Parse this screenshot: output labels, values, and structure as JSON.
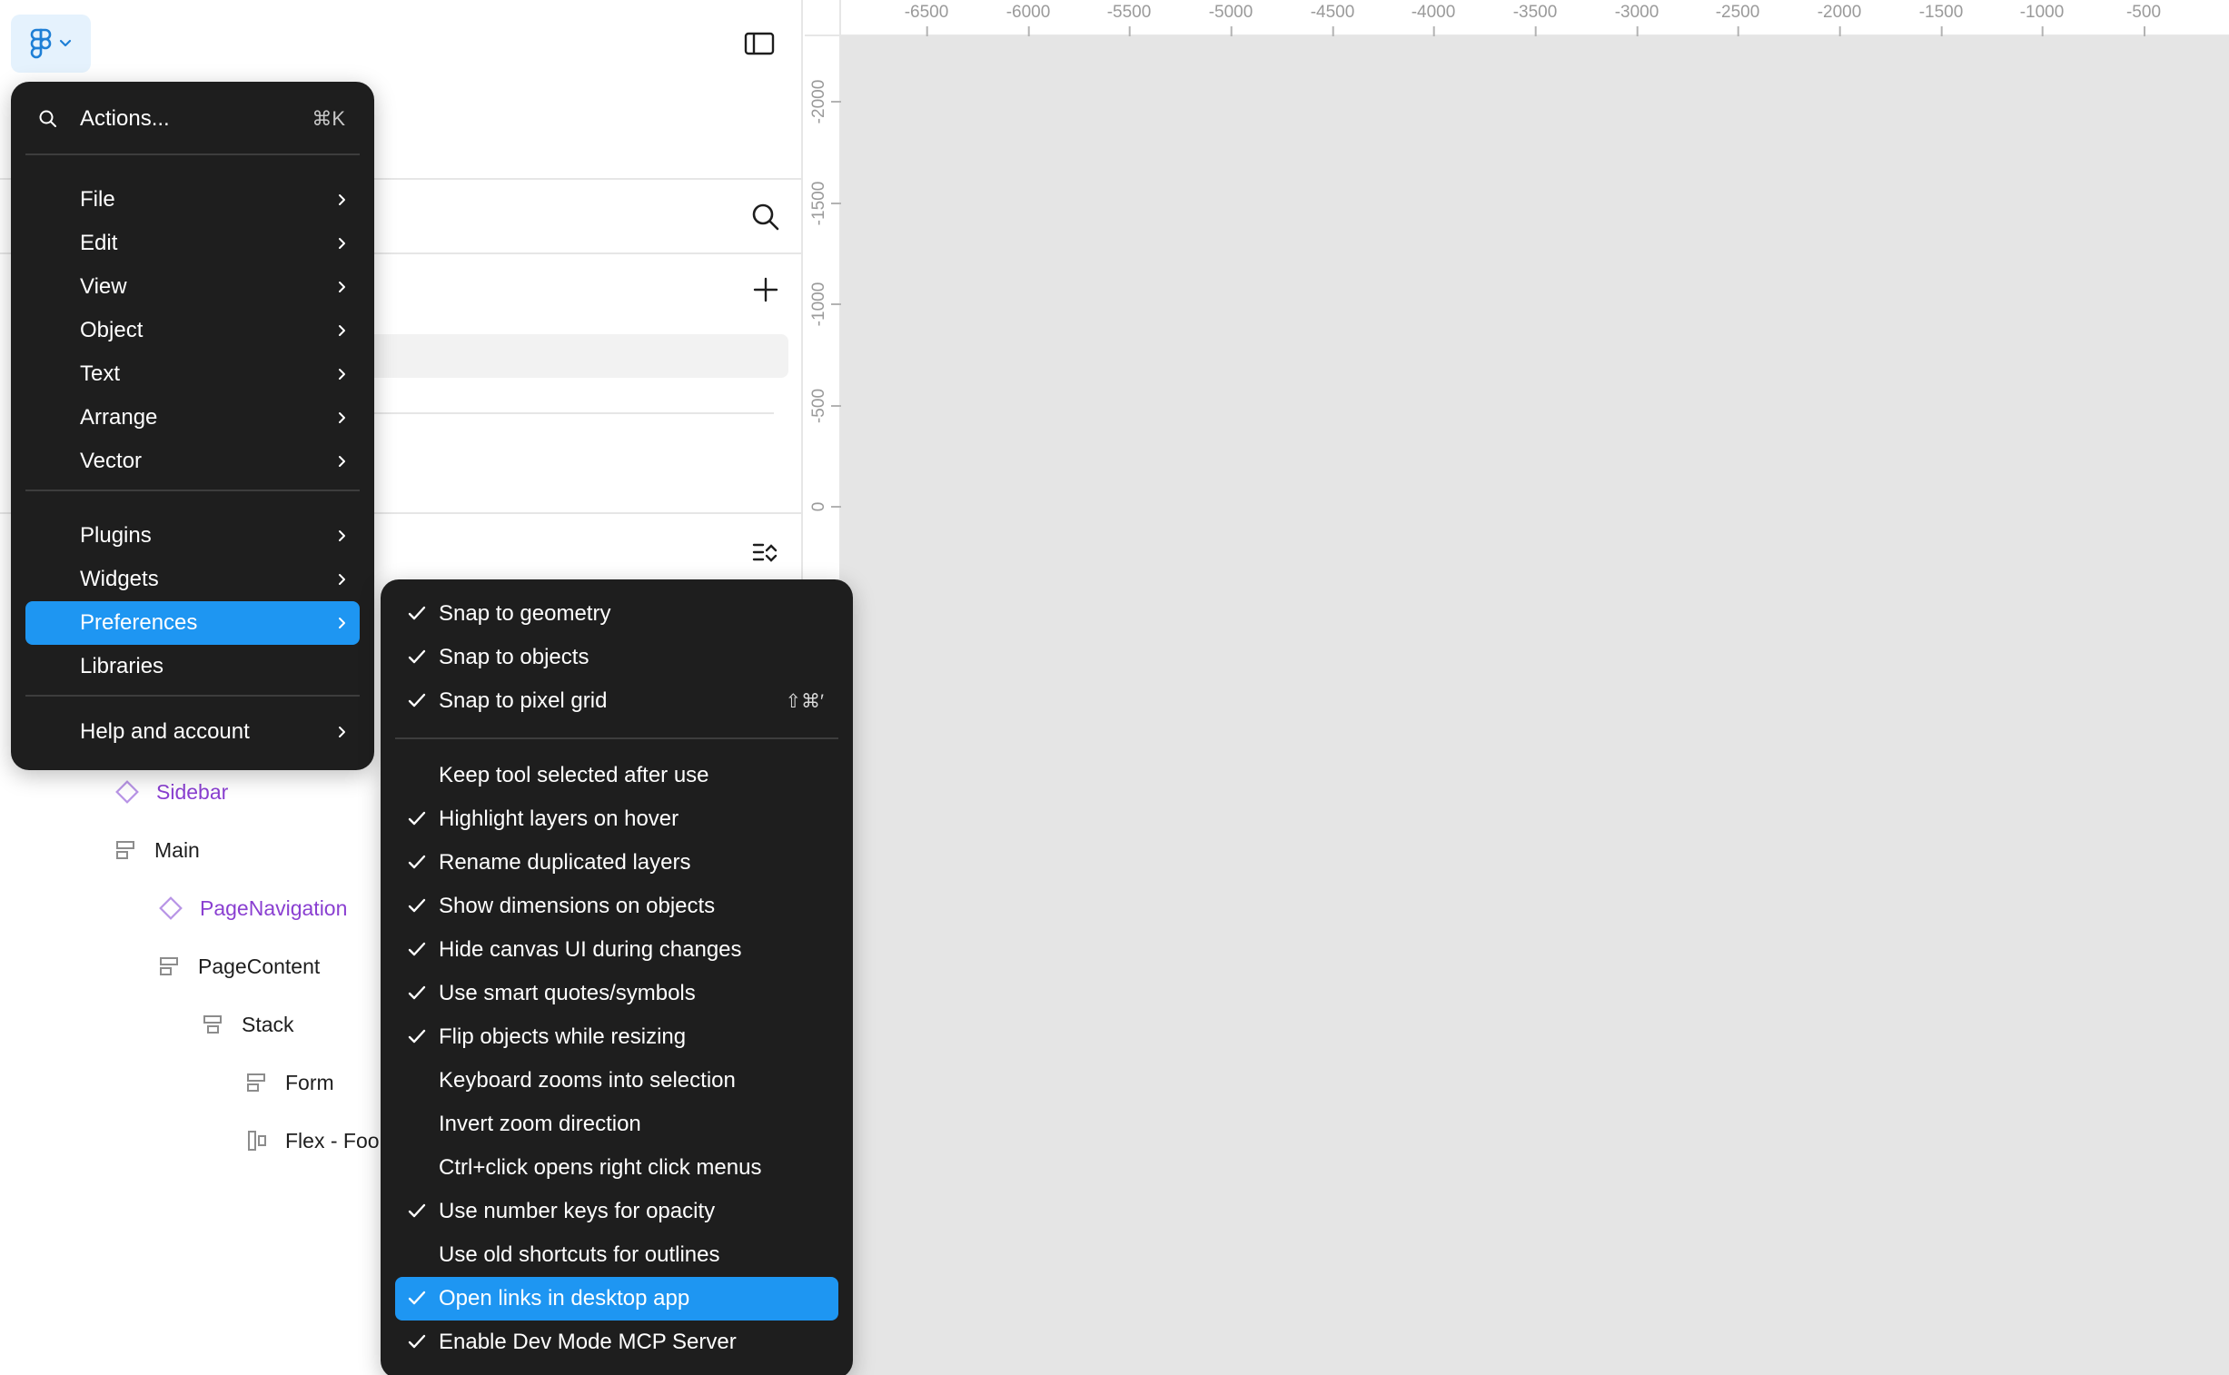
{
  "main_menu": {
    "actions": {
      "label": "Actions...",
      "shortcut": "⌘K"
    },
    "items": [
      {
        "label": "File"
      },
      {
        "label": "Edit"
      },
      {
        "label": "View"
      },
      {
        "label": "Object"
      },
      {
        "label": "Text"
      },
      {
        "label": "Arrange"
      },
      {
        "label": "Vector"
      },
      {
        "label": "Plugins"
      },
      {
        "label": "Widgets"
      },
      {
        "label": "Preferences"
      },
      {
        "label": "Libraries"
      },
      {
        "label": "Help and account"
      }
    ]
  },
  "preferences_menu": {
    "items": [
      {
        "label": "Snap to geometry",
        "checked": true
      },
      {
        "label": "Snap to objects",
        "checked": true
      },
      {
        "label": "Snap to pixel grid",
        "checked": true,
        "shortcut": "⇧⌘′"
      },
      {
        "label": "Keep tool selected after use",
        "checked": false
      },
      {
        "label": "Highlight layers on hover",
        "checked": true
      },
      {
        "label": "Rename duplicated layers",
        "checked": true
      },
      {
        "label": "Show dimensions on objects",
        "checked": true
      },
      {
        "label": "Hide canvas UI during changes",
        "checked": true
      },
      {
        "label": "Use smart quotes/symbols",
        "checked": true
      },
      {
        "label": "Flip objects while resizing",
        "checked": true
      },
      {
        "label": "Keyboard zooms into selection",
        "checked": false
      },
      {
        "label": "Invert zoom direction",
        "checked": false
      },
      {
        "label": "Ctrl+click opens right click menus",
        "checked": false
      },
      {
        "label": "Use number keys for opacity",
        "checked": true
      },
      {
        "label": "Use old shortcuts for outlines",
        "checked": false
      },
      {
        "label": "Open links in desktop app",
        "checked": true
      },
      {
        "label": "Enable Dev Mode MCP Server",
        "checked": true
      }
    ]
  },
  "layers": [
    {
      "name": "Sidebar",
      "icon": "component-icon",
      "kind": "component"
    },
    {
      "name": "Main",
      "icon": "frame-vertical-icon",
      "kind": "frame"
    },
    {
      "name": "PageNavigation",
      "icon": "component-icon",
      "kind": "component"
    },
    {
      "name": "PageContent",
      "icon": "frame-vertical-icon",
      "kind": "frame"
    },
    {
      "name": "Stack",
      "icon": "frame-vertical-icon",
      "kind": "frame"
    },
    {
      "name": "Form",
      "icon": "frame-vertical-icon",
      "kind": "frame"
    },
    {
      "name": "Flex - Foo",
      "icon": "frame-horizontal-icon",
      "kind": "frame"
    }
  ],
  "rulers": {
    "x_ticks": [
      "-6500",
      "-6000",
      "-5500",
      "-5000",
      "-4500",
      "-4000",
      "-3500",
      "-3000",
      "-2500",
      "-2000",
      "-1500",
      "-1000",
      "-500"
    ],
    "y_ticks": [
      "-2000",
      "-1500",
      "-1000",
      "-500",
      "0"
    ]
  },
  "colors": {
    "accent": "#1e96f2",
    "menu_bg": "#1e1e1e",
    "component": "#8a3fd1",
    "canvas": "#e5e5e5"
  },
  "state": {
    "highlighted_main_item": "Preferences",
    "highlighted_pref_item": "Open links in desktop app"
  }
}
